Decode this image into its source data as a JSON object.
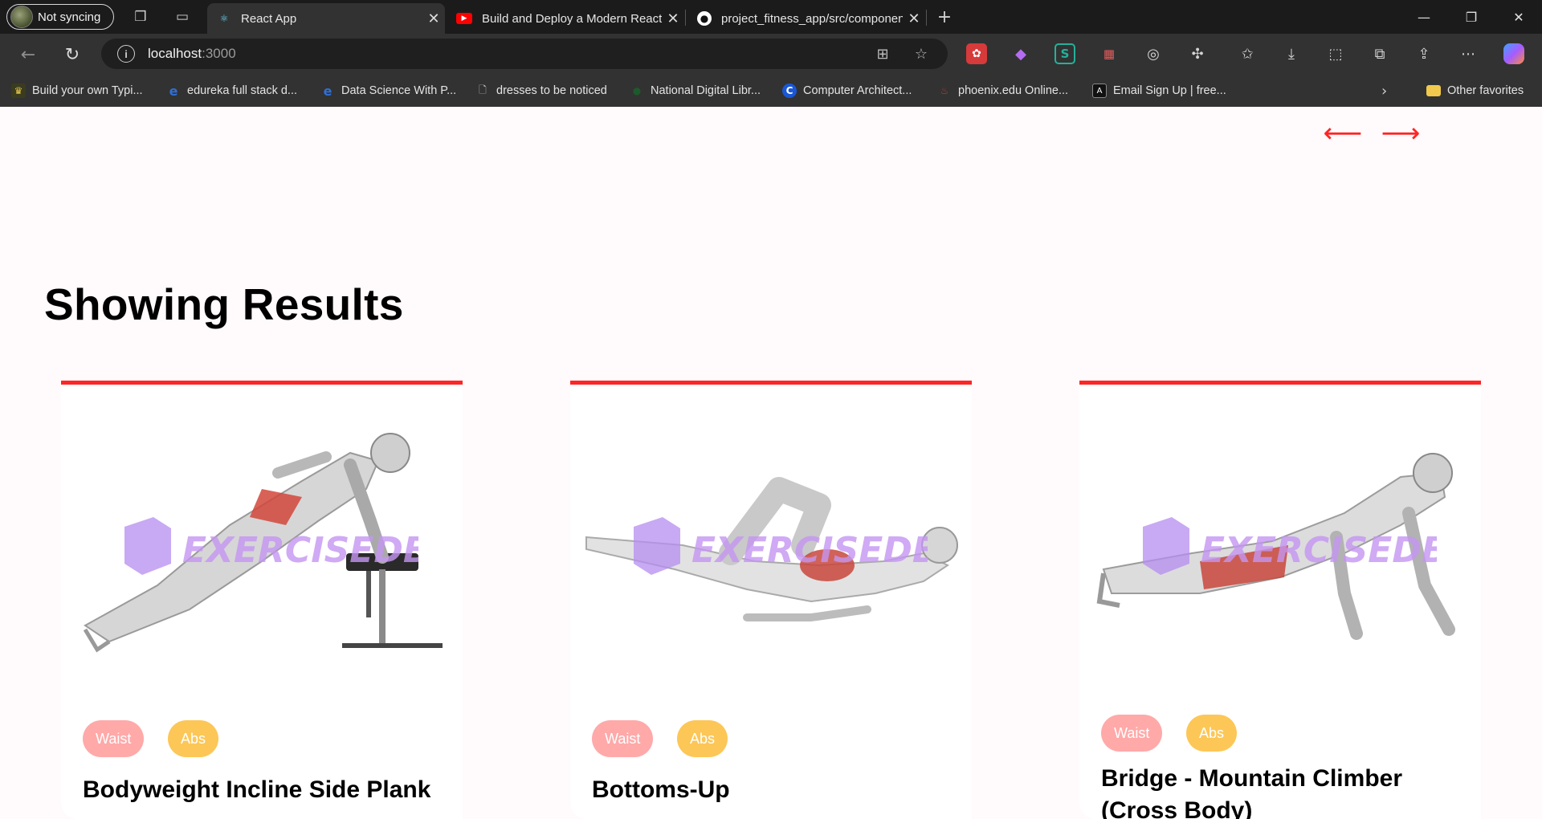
{
  "browser": {
    "profile_label": "Not syncing",
    "tabs": [
      {
        "title": "React App",
        "favicon": "react-icon",
        "active": true
      },
      {
        "title": "Build and Deploy a Modern React",
        "favicon": "youtube-icon",
        "active": false
      },
      {
        "title": "project_fitness_app/src/componen",
        "favicon": "github-icon",
        "active": false
      }
    ],
    "address": {
      "host": "localhost",
      "port": ":3000"
    },
    "bookmarks": [
      {
        "label": "Build your own Typi...",
        "icon": "bookmark-favicon"
      },
      {
        "label": "edureka full stack d...",
        "icon": "edureka-icon"
      },
      {
        "label": "Data Science With P...",
        "icon": "edureka-icon"
      },
      {
        "label": "dresses to be noticed",
        "icon": "page-icon"
      },
      {
        "label": "National Digital Libr...",
        "icon": "ndl-icon"
      },
      {
        "label": "Computer Architect...",
        "icon": "c-icon"
      },
      {
        "label": "phoenix.edu Online...",
        "icon": "phoenix-icon"
      },
      {
        "label": "Email Sign Up | free...",
        "icon": "vercel-icon"
      }
    ],
    "other_favorites": "Other favorites"
  },
  "page": {
    "heading": "Showing Results",
    "watermark": "EXERCISEDB",
    "accent_color": "#ff2625",
    "exercises": [
      {
        "name": "Bodyweight Incline Side Plank",
        "tags": [
          "Waist",
          "Abs"
        ]
      },
      {
        "name": "Bottoms-Up",
        "tags": [
          "Waist",
          "Abs"
        ]
      },
      {
        "name": "Bridge - Mountain Climber (Cross Body)",
        "tags": [
          "Waist",
          "Abs"
        ]
      }
    ]
  }
}
